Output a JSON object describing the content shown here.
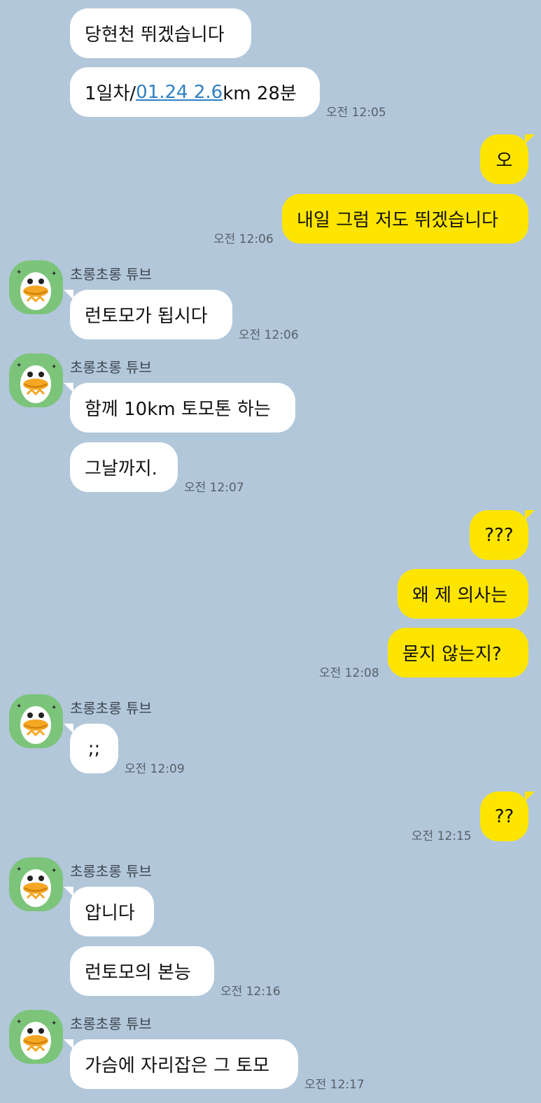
{
  "sender_name": "초롱초롱 튜브",
  "avatar_icon": "tube-duck-avatar-icon",
  "colors": {
    "background": "#b2c7da",
    "incoming_bubble": "#ffffff",
    "outgoing_bubble": "#fee500",
    "link": "#2f7fc2"
  },
  "messages": {
    "m1": "당현천 뛰겠습니다",
    "m2_prefix": "1일차/",
    "m2_link": "01.24 2.6",
    "m2_suffix": "km 28분",
    "m2_time": "오전 12:05",
    "m3": "오",
    "m4": "내일 그럼 저도 뛰겠습니다",
    "m4_time": "오전 12:06",
    "m5": "런토모가 됩시다",
    "m5_time": "오전 12:06",
    "m6": "함께 10km 토모톤 하는",
    "m7": "그날까지.",
    "m7_time": "오전 12:07",
    "m8": "???",
    "m9": "왜 제 의사는",
    "m10": "묻지 않는지?",
    "m10_time": "오전 12:08",
    "m11": ";;",
    "m11_time": "오전 12:09",
    "m12": "??",
    "m12_time": "오전 12:15",
    "m13": "압니다",
    "m14": "런토모의 본능",
    "m14_time": "오전 12:16",
    "m15": "가슴에 자리잡은 그 토모",
    "m15_time": "오전 12:17"
  }
}
